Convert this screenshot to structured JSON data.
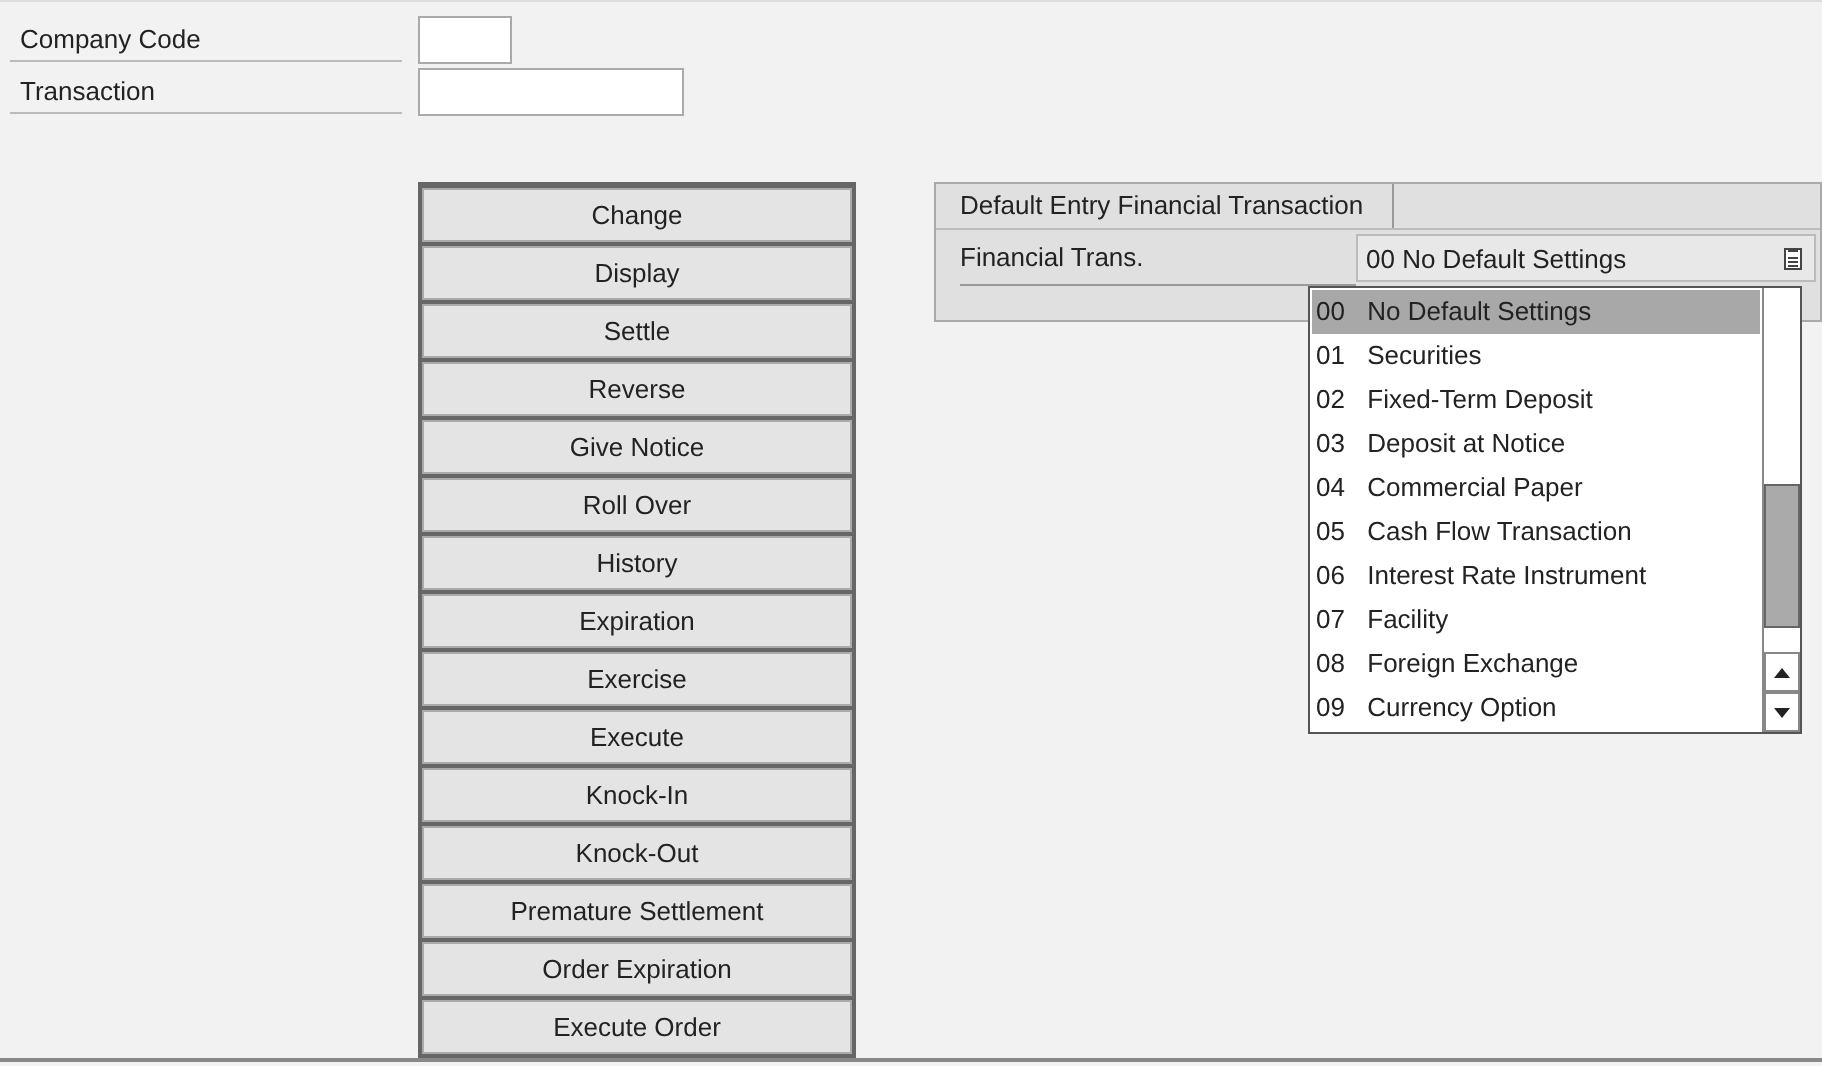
{
  "header_fields": [
    {
      "label": "Company Code"
    },
    {
      "label": "Transaction"
    }
  ],
  "actions": [
    "Change",
    "Display",
    "Settle",
    "Reverse",
    "Give Notice",
    "Roll Over",
    "History",
    "Expiration",
    "Exercise",
    "Execute",
    "Knock-In",
    "Knock-Out",
    "Premature Settlement",
    "Order Expiration",
    "Execute Order"
  ],
  "panel": {
    "title": "Default Entry Financial Transaction",
    "field_label": "Financial Trans.",
    "field_value": "00 No Default Settings",
    "dropdown": {
      "expanded": true,
      "options": [
        {
          "code": "00",
          "text": "No Default Settings",
          "selected": true
        },
        {
          "code": "01",
          "text": "Securities",
          "selected": false
        },
        {
          "code": "02",
          "text": "Fixed-Term Deposit",
          "selected": false
        },
        {
          "code": "03",
          "text": "Deposit at Notice",
          "selected": false
        },
        {
          "code": "04",
          "text": "Commercial Paper",
          "selected": false
        },
        {
          "code": "05",
          "text": "Cash Flow Transaction",
          "selected": false
        },
        {
          "code": "06",
          "text": "Interest Rate Instrument",
          "selected": false
        },
        {
          "code": "07",
          "text": "Facility",
          "selected": false
        },
        {
          "code": "08",
          "text": "Foreign Exchange",
          "selected": false
        },
        {
          "code": "09",
          "text": "Currency Option",
          "selected": false
        }
      ]
    }
  }
}
